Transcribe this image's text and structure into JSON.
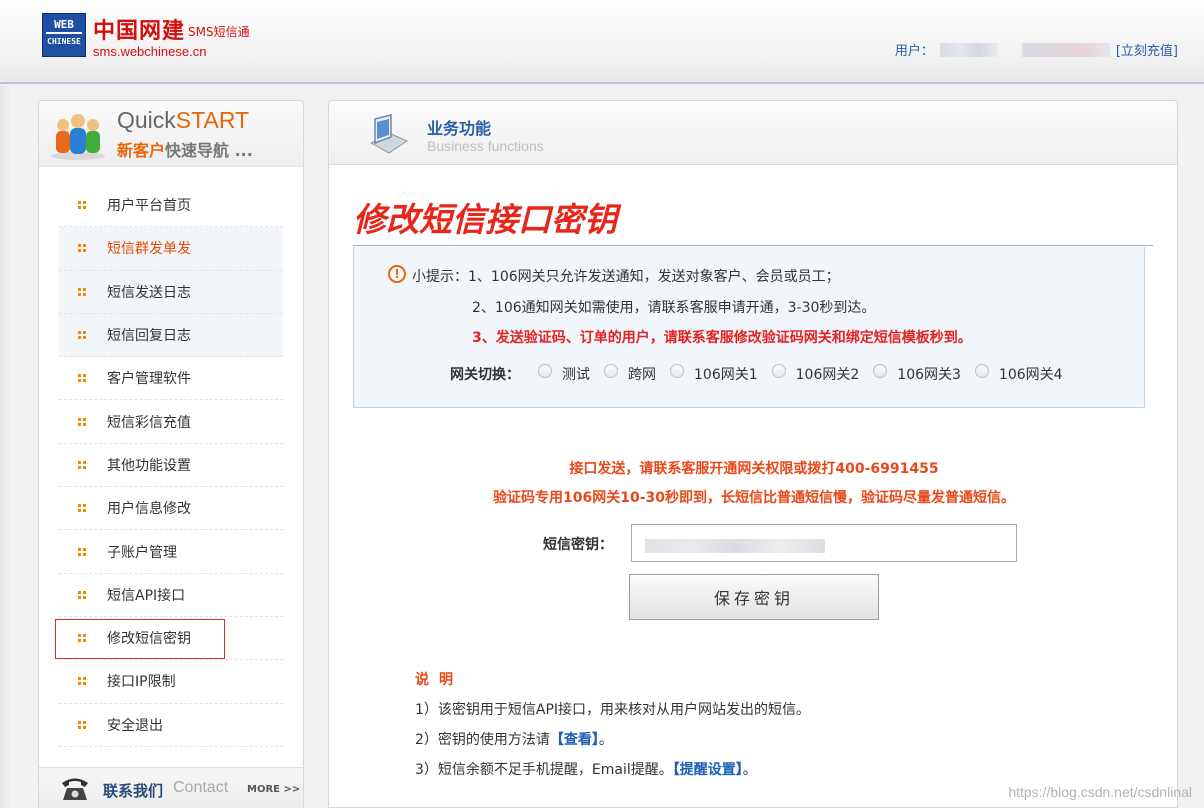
{
  "header": {
    "logo_box_line1": "WEB",
    "logo_box_line2": "CHINESE",
    "logo_cn": "中国网建",
    "logo_sms": "SMS短信通",
    "logo_url": "sms.webchinese.cn",
    "user_label": "用户：",
    "recharge_link": "[立刻充值]"
  },
  "sidebar": {
    "qs_title_a": "Quick",
    "qs_title_b": "START",
    "qs_sub_a": "新客户",
    "qs_sub_b": "快速导航",
    "qs_sub_dots": " ...",
    "items": [
      {
        "label": "用户平台首页"
      },
      {
        "label": "短信群发单发"
      },
      {
        "label": "短信发送日志"
      },
      {
        "label": "短信回复日志"
      },
      {
        "label": "客户管理软件"
      },
      {
        "label": "短信彩信充值"
      },
      {
        "label": "其他功能设置"
      },
      {
        "label": "用户信息修改"
      },
      {
        "label": "子账户管理"
      },
      {
        "label": "短信API接口"
      },
      {
        "label": "修改短信密钥"
      },
      {
        "label": "接口IP限制"
      },
      {
        "label": "安全退出"
      }
    ],
    "contact_cn": "联系我们",
    "contact_en": "Contact",
    "contact_more": "MORE >>"
  },
  "main": {
    "head_title": "业务功能",
    "head_sub": "Business functions",
    "page_title": "修改短信接口密钥",
    "tips": {
      "prefix": "小提示：",
      "line1": "1、106网关只允许发送通知，发送对象客户、会员或员工；",
      "line2": "2、106通知网关如需使用，请联系客服申请开通，3-30秒到达。",
      "line3": "3、发送验证码、订单的用户，请联系客服修改验证码网关和绑定短信模板秒到。"
    },
    "gateway": {
      "label": "网关切换：",
      "options": [
        "测试",
        "跨网",
        "106网关1",
        "106网关2",
        "106网关3",
        "106网关4"
      ]
    },
    "notice1": "接口发送，请联系客服开通网关权限或拨打400-6991455",
    "notice2": "验证码专用106网关10-30秒即到，长短信比普通短信慢，验证码尽量发普通短信。",
    "key_label": "短信密钥：",
    "key_value": "",
    "save_label": "保存密钥",
    "desc": {
      "title": "说明",
      "line1": "1）该密钥用于短信API接口，用来核对从用户网站发出的短信。",
      "line2_a": "2）密钥的使用方法请",
      "line2_link": "【查看】",
      "line2_b": "。",
      "line3_a": "3）短信余额不足手机提醒，Email提醒。",
      "line3_link": "【提醒设置】",
      "line3_b": "。"
    }
  },
  "watermark": "https://blog.csdn.net/csdnlinal",
  "colors": {
    "accent_red": "#e8261b",
    "link_blue": "#2a5ea8",
    "orange": "#e8650a"
  }
}
